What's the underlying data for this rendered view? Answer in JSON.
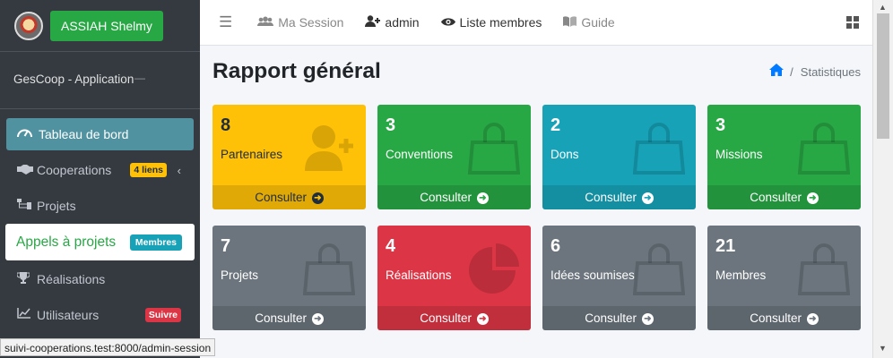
{
  "sidebar": {
    "user_button": "ASSIAH Shelmy",
    "app_label": "GesCoop - Application",
    "items": [
      {
        "label": "Tableau de bord",
        "icon": "tachometer-icon"
      },
      {
        "label": "Cooperations",
        "icon": "handshake-icon",
        "badge": "4 liens"
      },
      {
        "label": "Projets",
        "icon": "sitemap-icon"
      },
      {
        "label": "Appels à projets",
        "badge": "Membres"
      },
      {
        "label": "Réalisations",
        "icon": "trophy-icon"
      },
      {
        "label": "Utilisateurs",
        "icon": "chart-line-icon",
        "badge": "Suivre"
      }
    ]
  },
  "topnav": {
    "session": "Ma Session",
    "admin": "admin",
    "members": "Liste membres",
    "guide": "Guide"
  },
  "page": {
    "title": "Rapport général",
    "breadcrumb": "Statistiques"
  },
  "boxes": [
    {
      "count": "8",
      "label": "Partenaires",
      "footer": "Consulter",
      "color": "#ffc107",
      "icon": "user-plus-icon"
    },
    {
      "count": "3",
      "label": "Conventions",
      "footer": "Consulter",
      "color": "#28a745",
      "icon": "shopping-bag-icon"
    },
    {
      "count": "2",
      "label": "Dons",
      "footer": "Consulter",
      "color": "#17a2b8",
      "icon": "shopping-bag-icon"
    },
    {
      "count": "3",
      "label": "Missions",
      "footer": "Consulter",
      "color": "#28a745",
      "icon": "shopping-bag-icon"
    },
    {
      "count": "7",
      "label": "Projets",
      "footer": "Consulter",
      "color": "#6c757d",
      "icon": "shopping-bag-icon"
    },
    {
      "count": "4",
      "label": "Réalisations",
      "footer": "Consulter",
      "color": "#dc3545",
      "icon": "pie-chart-icon"
    },
    {
      "count": "6",
      "label": "Idées soumises",
      "footer": "Consulter",
      "color": "#6c757d",
      "icon": "shopping-bag-icon"
    },
    {
      "count": "21",
      "label": "Membres",
      "footer": "Consulter",
      "color": "#6c757d",
      "icon": "shopping-bag-icon"
    }
  ],
  "status_url": "suivi-cooperations.test:8000/admin-session"
}
